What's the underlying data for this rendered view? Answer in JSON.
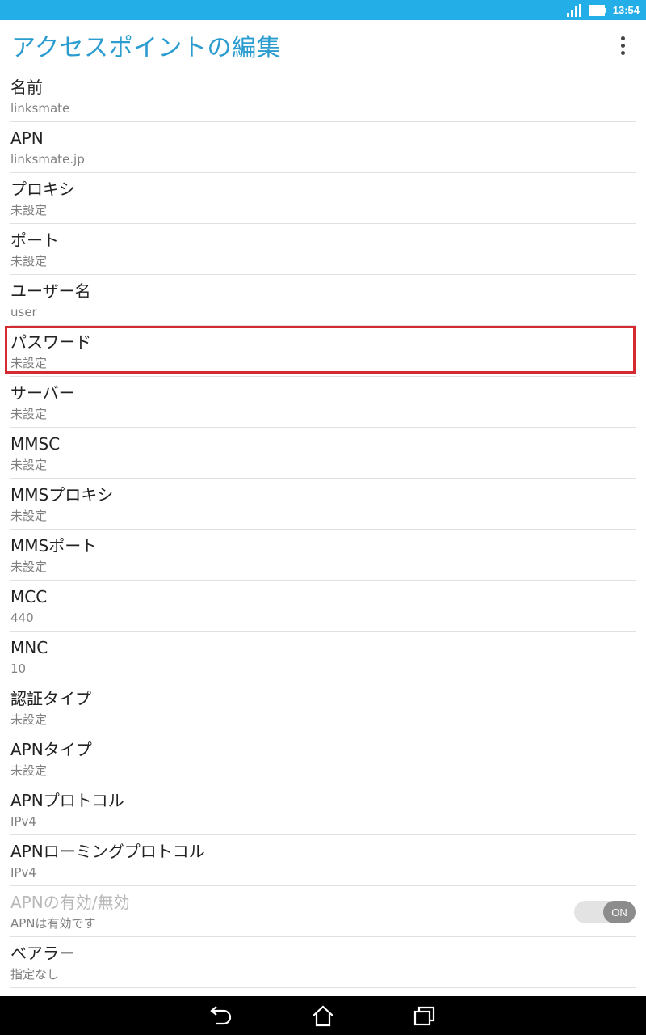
{
  "status": {
    "time": "13:54"
  },
  "header": {
    "title": "アクセスポイントの編集"
  },
  "fields": [
    {
      "label": "名前",
      "value": "linksmate"
    },
    {
      "label": "APN",
      "value": "linksmate.jp"
    },
    {
      "label": "プロキシ",
      "value": "未設定"
    },
    {
      "label": "ポート",
      "value": "未設定"
    },
    {
      "label": "ユーザー名",
      "value": "user"
    },
    {
      "label": "パスワード",
      "value": "未設定"
    },
    {
      "label": "サーバー",
      "value": "未設定"
    },
    {
      "label": "MMSC",
      "value": "未設定"
    },
    {
      "label": "MMSプロキシ",
      "value": "未設定"
    },
    {
      "label": "MMSポート",
      "value": "未設定"
    },
    {
      "label": "MCC",
      "value": "440"
    },
    {
      "label": "MNC",
      "value": "10"
    },
    {
      "label": "認証タイプ",
      "value": "未設定"
    },
    {
      "label": "APNタイプ",
      "value": "未設定"
    },
    {
      "label": "APNプロトコル",
      "value": "IPv4"
    },
    {
      "label": "APNローミングプロトコル",
      "value": "IPv4"
    },
    {
      "label": "APNの有効/無効",
      "value": "APNは有効です",
      "toggle": "ON"
    },
    {
      "label": "ベアラー",
      "value": "指定なし"
    }
  ],
  "colors": {
    "accent": "#2a9ccf",
    "status_bar": "#23aee7",
    "highlight": "#d62a32"
  }
}
